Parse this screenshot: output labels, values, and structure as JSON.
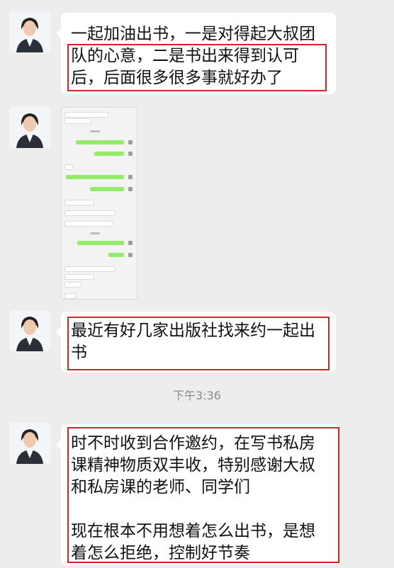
{
  "messages": [
    {
      "lines": [
        "一起加油出书，一是对得起大叔团",
        "队的心意，二是书出来得到认可",
        "后，后面很多很多事就好办了"
      ]
    },
    {
      "image": "chat-screenshot-thumbnail"
    },
    {
      "lines": [
        "最近有好几家出版社找来约一起出",
        "书"
      ]
    },
    {
      "lines": [
        "时不时收到合作邀约，在写书私房",
        "课精神物质双丰收，特别感谢大叔",
        "和私房课的老师、同学们",
        "",
        "现在根本不用想着怎么出书，是想",
        "着怎么拒绝，控制好节奏"
      ]
    }
  ],
  "timestamp": "下午3:36",
  "colors": {
    "background": "#ededed",
    "bubble": "#ffffff",
    "highlight": "#d2232a",
    "sent_bubble": "#95ec69"
  }
}
